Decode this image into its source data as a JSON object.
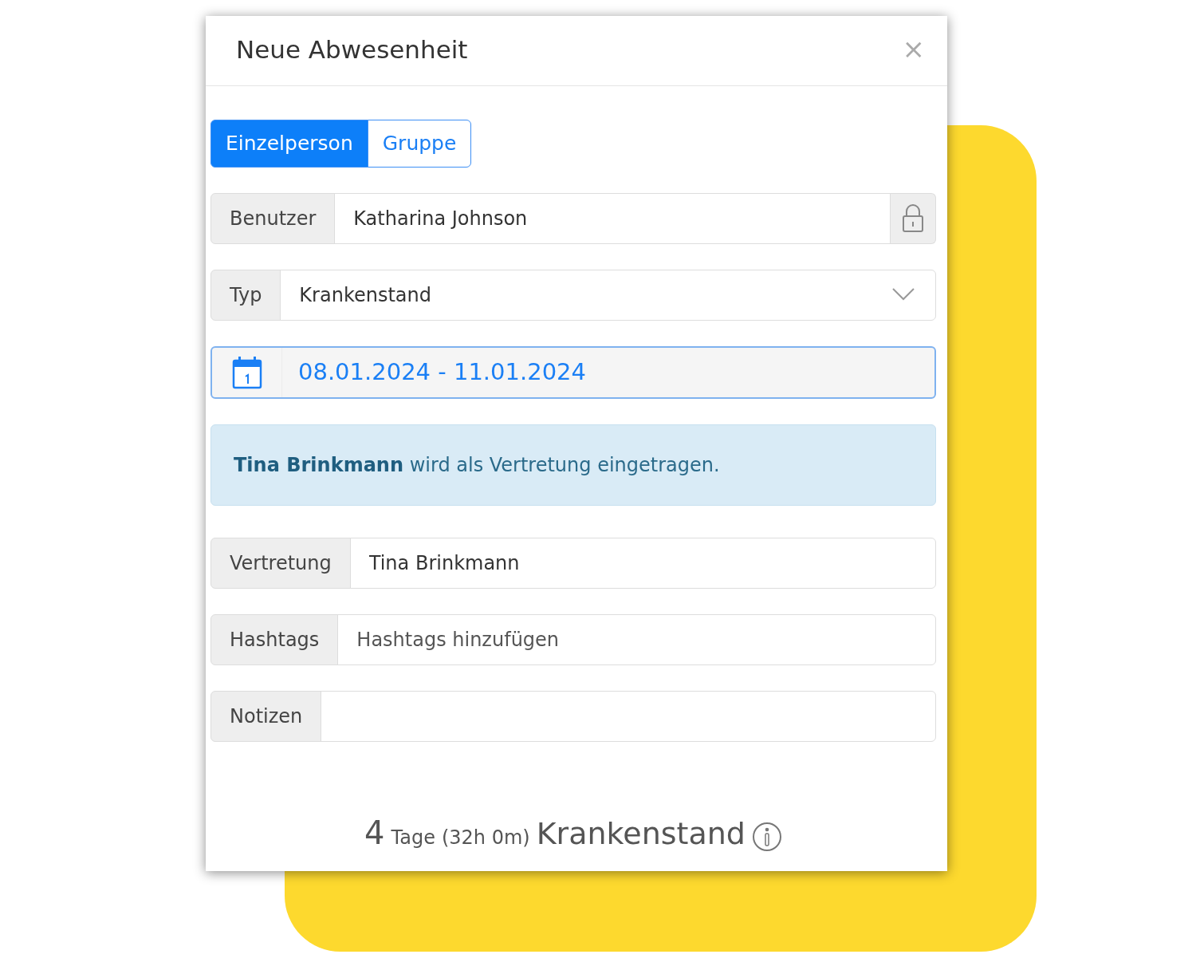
{
  "dialog": {
    "title": "Neue Abwesenheit",
    "close": "×"
  },
  "mode_toggle": [
    {
      "label": "Einzelperson",
      "selected": true
    },
    {
      "label": "Gruppe",
      "selected": false
    }
  ],
  "fields": [
    {
      "kind": "locked",
      "label": "Benutzer",
      "value": "Katharina Johnson"
    },
    {
      "kind": "select",
      "label": "Typ",
      "value": "Krankenstand"
    },
    {
      "kind": "date",
      "value": "08.01.2024 - 11.01.2024"
    },
    {
      "kind": "alert",
      "text": "**Tina Brinkmann** wird als Vertretung eingetragen."
    },
    {
      "kind": "text",
      "label": "Vertretung",
      "value": "Tina Brinkmann"
    },
    {
      "kind": "text",
      "label": "Hashtags",
      "placeholder": "Hashtags hinzufügen"
    },
    {
      "kind": "text",
      "label": "Notizen"
    }
  ],
  "summary": {
    "count": "4",
    "unit": "Tage",
    "hours": "(32h 0m)",
    "type": "Krankenstand"
  }
}
